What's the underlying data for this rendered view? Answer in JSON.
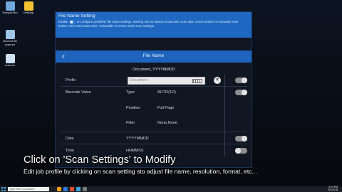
{
  "desktop": {
    "icons": [
      {
        "label": "Recycle Bin",
        "color": "#6fa8dc"
      },
      {
        "label": "Desktop",
        "color": "#f1c232"
      },
      {
        "label": "shortcut file scanner",
        "color": "#9fc5e8"
      },
      {
        "label": "scanner",
        "color": "#cfe2f3"
      }
    ]
  },
  "dialog": {
    "title": "File Name Setting",
    "desc_before": "Enable",
    "desc_after": "to configure predefine file name settings. Naming can be based on barcode, scan date, serial number or manually enter before each scan basis when 'Selectable' is check under scan settings.",
    "nav_title": "File Name",
    "back_glyph": "‹",
    "template": "Document_YYYYMMDD",
    "prefix": {
      "label": "Prefix",
      "placeholder": "Document",
      "clear_glyph": "×",
      "enabled": true
    },
    "barcode": {
      "label": "Barcode Value",
      "type_label": "Type",
      "type_value": "AUTO(1D)",
      "position_label": "Position",
      "position_value": "Full Page",
      "filter_label": "Filter",
      "filter_value": "None,None",
      "enabled": true
    },
    "date": {
      "label": "Date",
      "value": "YYYYMMDD",
      "enabled": true
    },
    "time": {
      "label": "Time",
      "value": "HHMMSS",
      "enabled": false
    }
  },
  "caption": {
    "line1": "Click on 'Scan Settings' to Modify",
    "line2": "Edit job profile by clicking on scan setting sto adjust file name, resolution, format, etc..."
  },
  "taskbar": {
    "search_placeholder": "Type here to search",
    "app_colors": [
      "#f0a30a",
      "#2b79d8",
      "#e04a2f",
      "#3aa6dd",
      "#7a7a7a"
    ],
    "time": "3:19 PM",
    "date": "5/2/2018"
  }
}
